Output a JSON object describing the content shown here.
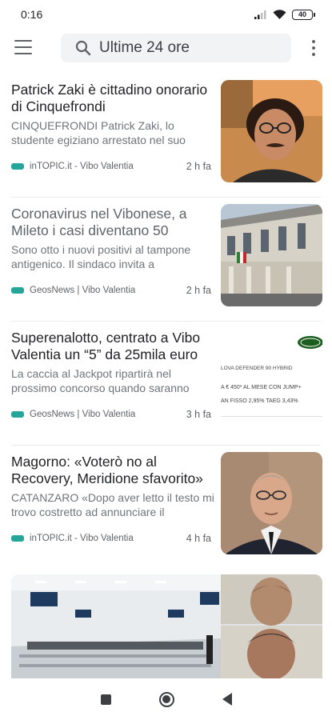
{
  "status": {
    "time": "0:16",
    "battery": "40"
  },
  "search": {
    "query": "Ultime 24 ore"
  },
  "articles": [
    {
      "title": "Patrick Zaki è cittadino onorario di Cinquefrondi",
      "snippet": "CINQUEFRONDI Patrick Zaki, lo studente egiziano arrestato nel suo",
      "source": "inTOPIC.it - Vibo Valentia",
      "time": "2 h fa",
      "visited": false
    },
    {
      "title": "Coronavirus nel Vibonese, a Mileto i casi diventano 50",
      "snippet": "Sono otto i nuovi positivi al tampone antigenico. Il sindaco invita a",
      "source": "GeosNews | Vibo Valentia",
      "time": "2 h fa",
      "visited": true
    },
    {
      "title": "Superenalotto, centrato a Vibo Valentia un “5” da 25mila euro",
      "snippet": "La caccia al Jackpot ripartirà nel prossimo concorso quando saranno",
      "source": "GeosNews | Vibo Valentia",
      "time": "3 h fa",
      "visited": false,
      "ad": {
        "line1": "LOVA DEFENDER 90 HYBRID",
        "line2": "A € 450* AL MESE CON JUMP+",
        "line3": "AN FISSO 2,95% TAEG 3,43%"
      }
    },
    {
      "title": "Magorno: «Voterò no al Recovery, Meridione sfavorito»",
      "snippet": "CATANZARO «Dopo aver letto il testo mi trovo costretto ad annunciare il",
      "source": "inTOPIC.it - Vibo Valentia",
      "time": "4 h fa",
      "visited": false
    }
  ],
  "colors": {
    "accent": "#26a69a",
    "text": "#202124",
    "muted": "#70757a"
  }
}
